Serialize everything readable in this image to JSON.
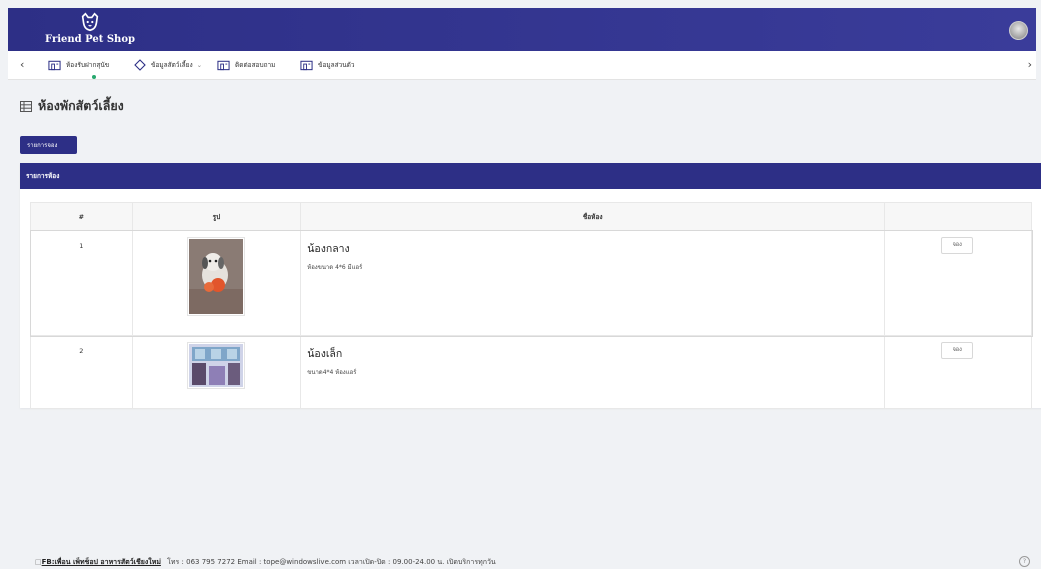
{
  "header": {
    "brand": "Friend Pet Shop",
    "logo_icon": "dog-face-icon",
    "avatar_icon": "user-avatar-icon"
  },
  "nav": {
    "back_icon": "chevron-left-icon",
    "forward_icon": "chevron-right-icon",
    "items": [
      {
        "label": "ห้องรับฝากสุนัข",
        "icon": "building-icon"
      },
      {
        "label": "ข้อมูลสัตว์เลี้ยง",
        "icon": "diamond-icon"
      },
      {
        "label": "ติดต่อสอบถาม",
        "icon": "building-icon"
      },
      {
        "label": "ข้อมูลส่วนตัว",
        "icon": "building-icon"
      }
    ]
  },
  "page": {
    "title": "ห้องพักสัตว์เลี้ยง",
    "title_icon": "table-icon",
    "booking_list_button": "รายการจอง"
  },
  "rooms_card": {
    "header": "รายการห้อง",
    "columns": [
      "#",
      "รูป",
      "ชื่อห้อง",
      ""
    ],
    "rows": [
      {
        "index": "1",
        "name": "น้องกลาง",
        "description": "ห้องขนาด 4*6 มีแอร์",
        "button": "จอง"
      },
      {
        "index": "2",
        "name": "น้องเล็ก",
        "description": "ขนาด4*4 ห้องแอร์",
        "button": "จอง"
      }
    ]
  },
  "footer": {
    "link_text": "FB:เพื่อน เพ็ทช็อป อาหารสัตว์เชียงใหม่",
    "info": "โทร : 063 795 7272  Email : tope@windowslive.com  เวลาเปิด-ปิด : 09.00-24.00 น. เปิดบริการทุกวัน",
    "help_icon": "help-circle-icon"
  },
  "colors": {
    "primary": "#2d2f86",
    "background": "#f0f2f5",
    "active_dot": "#27a86e"
  }
}
